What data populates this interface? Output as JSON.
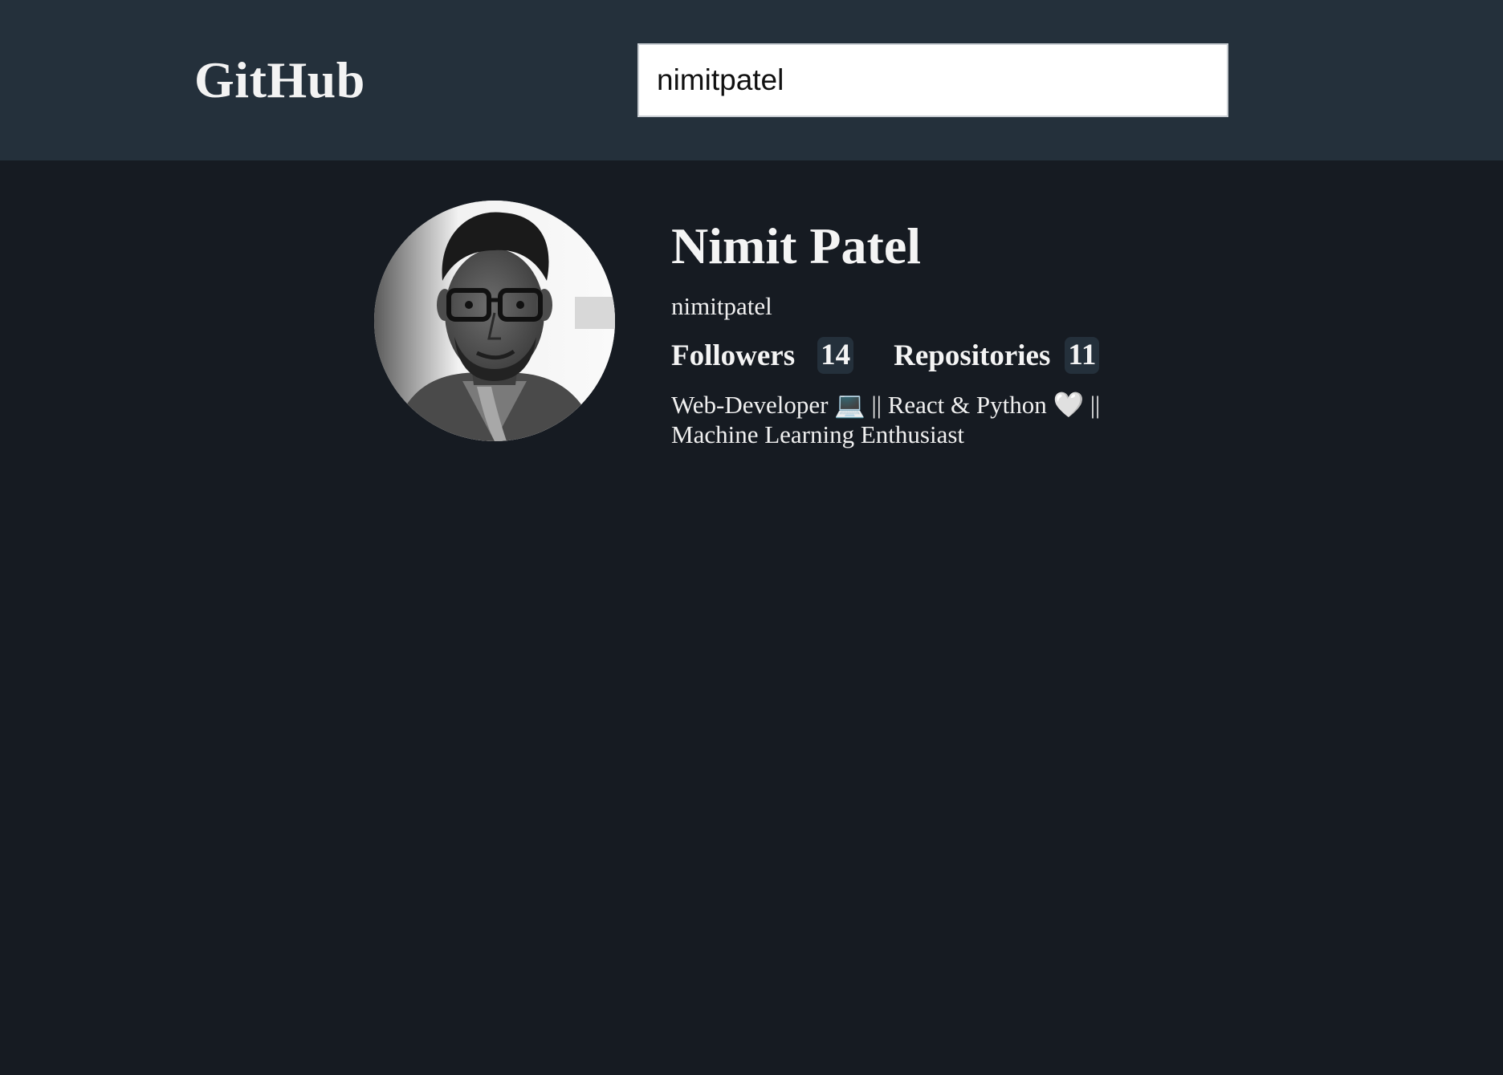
{
  "header": {
    "brand": "GitHub",
    "search": {
      "value": "nimitpatel",
      "placeholder": ""
    }
  },
  "profile": {
    "avatar_icon": "user-avatar-photo",
    "name": "Nimit Patel",
    "login": "nimitpatel",
    "stats": {
      "followers_label": "Followers",
      "followers_count": "14",
      "repositories_label": "Repositories",
      "repositories_count": "11"
    },
    "bio": "Web-Developer 💻 || React & Python 🤍 || Machine Learning Enthusiast"
  },
  "colors": {
    "header_bg": "#24303b",
    "page_bg": "#161b22",
    "text": "#ffffff",
    "badge_bg": "#24303b"
  }
}
